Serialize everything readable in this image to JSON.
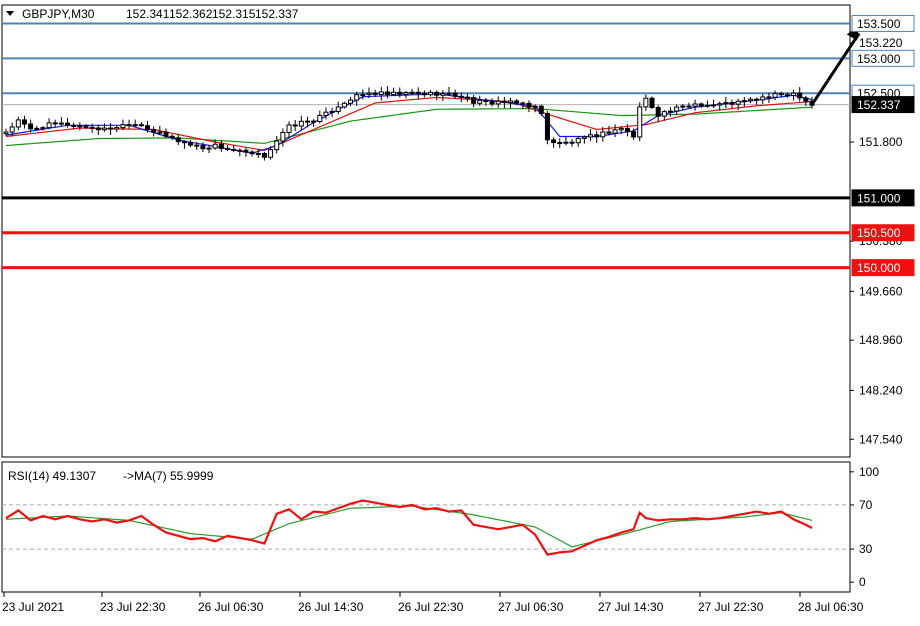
{
  "header": {
    "symbol_label": "GBPJPY,M30",
    "ohlc": [
      "152.341",
      "152.362",
      "152.315",
      "152.337"
    ]
  },
  "rsi_header": {
    "rsi_label": "RSI(14) 49.1307",
    "ma_label": "->MA(7) 55.9999"
  },
  "colors": {
    "background": "#ffffff",
    "frame": "#000000",
    "candle": "#000000",
    "ma_fast": "#1515ee",
    "ma_mid": "#e01010",
    "ma_slow": "#149614",
    "level_blue": "#4f83b8",
    "level_black": "#000000",
    "level_red": "#ee1111",
    "rsi_line": "#ee1111",
    "rsi_ma": "#2c9a2c",
    "arrow": "#000000"
  },
  "chart_data": [
    {
      "type": "candlestick",
      "symbol": "GBPJPY",
      "timeframe": "M30",
      "ylim": [
        147.3,
        153.75
      ],
      "y_ticks": [
        "153.220",
        "151.800",
        "150.380",
        "149.660",
        "148.960",
        "148.240",
        "147.540"
      ],
      "x_ticks": [
        "23 Jul 2021",
        "23 Jul 22:30",
        "26 Jul 06:30",
        "26 Jul 14:30",
        "26 Jul 22:30",
        "27 Jul 06:30",
        "27 Jul 14:30",
        "27 Jul 22:30",
        "28 Jul 06:30"
      ],
      "close_profile": [
        [
          0,
          151.95
        ],
        [
          2,
          152.1
        ],
        [
          4,
          151.98
        ],
        [
          6,
          152.03
        ],
        [
          8,
          152.06
        ],
        [
          10,
          152.05
        ],
        [
          13,
          152.02
        ],
        [
          16,
          151.98
        ],
        [
          18,
          152.02
        ],
        [
          20,
          152.07
        ],
        [
          22,
          152.05
        ],
        [
          24,
          151.95
        ],
        [
          26,
          151.88
        ],
        [
          28,
          151.82
        ],
        [
          30,
          151.76
        ],
        [
          32,
          151.72
        ],
        [
          34,
          151.75
        ],
        [
          36,
          151.7
        ],
        [
          38,
          151.66
        ],
        [
          40,
          151.62
        ],
        [
          42,
          151.6
        ],
        [
          44,
          151.82
        ],
        [
          46,
          152.02
        ],
        [
          48,
          152.08
        ],
        [
          50,
          152.12
        ],
        [
          52,
          152.2
        ],
        [
          54,
          152.32
        ],
        [
          56,
          152.42
        ],
        [
          58,
          152.48
        ],
        [
          60,
          152.5
        ],
        [
          62,
          152.48
        ],
        [
          64,
          152.49
        ],
        [
          66,
          152.5
        ],
        [
          68,
          152.49
        ],
        [
          70,
          152.5
        ],
        [
          72,
          152.48
        ],
        [
          74,
          152.46
        ],
        [
          76,
          152.38
        ],
        [
          78,
          152.36
        ],
        [
          80,
          152.38
        ],
        [
          82,
          152.36
        ],
        [
          84,
          152.35
        ],
        [
          86,
          152.3
        ],
        [
          87,
          152.2
        ],
        [
          88,
          151.85
        ],
        [
          89,
          151.8
        ],
        [
          90,
          151.78
        ],
        [
          92,
          151.8
        ],
        [
          94,
          151.85
        ],
        [
          96,
          151.9
        ],
        [
          98,
          151.95
        ],
        [
          100,
          152.0
        ],
        [
          102,
          151.88
        ],
        [
          103,
          152.3
        ],
        [
          104,
          152.42
        ],
        [
          106,
          152.2
        ],
        [
          108,
          152.25
        ],
        [
          110,
          152.3
        ],
        [
          112,
          152.35
        ],
        [
          114,
          152.33
        ],
        [
          116,
          152.34
        ],
        [
          118,
          152.36
        ],
        [
          120,
          152.38
        ],
        [
          122,
          152.42
        ],
        [
          124,
          152.45
        ],
        [
          126,
          152.48
        ],
        [
          128,
          152.5
        ],
        [
          129,
          152.46
        ],
        [
          130,
          152.4
        ],
        [
          131,
          152.337
        ]
      ],
      "series": [
        {
          "name": "",
          "role": "fast MA",
          "values": [
            [
              0,
              151.9
            ],
            [
              10,
              152.04
            ],
            [
              20,
              152.04
            ],
            [
              28,
              151.83
            ],
            [
              40,
              151.64
            ],
            [
              44,
              151.75
            ],
            [
              50,
              152.08
            ],
            [
              58,
              152.45
            ],
            [
              70,
              152.49
            ],
            [
              80,
              152.38
            ],
            [
              86,
              152.31
            ],
            [
              90,
              151.88
            ],
            [
              96,
              151.88
            ],
            [
              102,
              151.96
            ],
            [
              106,
              152.18
            ],
            [
              112,
              152.3
            ],
            [
              122,
              152.4
            ],
            [
              128,
              152.47
            ],
            [
              131,
              152.41
            ]
          ]
        },
        {
          "name": "",
          "role": "mid MA",
          "values": [
            [
              0,
              151.88
            ],
            [
              12,
              152.0
            ],
            [
              24,
              151.98
            ],
            [
              34,
              151.8
            ],
            [
              42,
              151.68
            ],
            [
              50,
              151.98
            ],
            [
              60,
              152.36
            ],
            [
              70,
              152.44
            ],
            [
              82,
              152.38
            ],
            [
              88,
              152.2
            ],
            [
              96,
              151.98
            ],
            [
              104,
              152.05
            ],
            [
              112,
              152.22
            ],
            [
              122,
              152.32
            ],
            [
              131,
              152.38
            ]
          ]
        },
        {
          "name": "",
          "role": "slow MA",
          "values": [
            [
              0,
              151.75
            ],
            [
              15,
              151.85
            ],
            [
              28,
              151.86
            ],
            [
              42,
              151.78
            ],
            [
              56,
              152.1
            ],
            [
              70,
              152.27
            ],
            [
              86,
              152.28
            ],
            [
              100,
              152.18
            ],
            [
              112,
              152.2
            ],
            [
              131,
              152.3
            ]
          ]
        }
      ],
      "levels": [
        {
          "value": 153.5,
          "label": "153.500",
          "color": "#4f83b8"
        },
        {
          "value": 153.0,
          "label": "153.000",
          "color": "#4f83b8"
        },
        {
          "value": 152.5,
          "label": "152.500",
          "color": "#4f83b8"
        },
        {
          "value": 152.337,
          "label": "152.337",
          "color": "#000000",
          "current": true
        },
        {
          "value": 151.0,
          "label": "151.000",
          "color": "#000000"
        },
        {
          "value": 150.5,
          "label": "150.500",
          "color": "#ee1111"
        },
        {
          "value": 150.0,
          "label": "150.000",
          "color": "#ee1111"
        }
      ],
      "projection_arrow": {
        "from": [
          131,
          152.337
        ],
        "to": [
          138,
          153.5
        ]
      }
    },
    {
      "type": "line",
      "indicator": "RSI(14)",
      "ylim": [
        -8,
        108
      ],
      "y_ticks": [
        "100",
        "70",
        "30",
        "0"
      ],
      "levels": [
        70,
        30
      ],
      "series": [
        {
          "name": "RSI(14)",
          "values": [
            [
              0,
              58
            ],
            [
              2,
              65
            ],
            [
              4,
              56
            ],
            [
              6,
              60
            ],
            [
              8,
              57
            ],
            [
              10,
              60
            ],
            [
              12,
              57
            ],
            [
              14,
              55
            ],
            [
              16,
              57
            ],
            [
              18,
              54
            ],
            [
              20,
              56
            ],
            [
              22,
              60
            ],
            [
              24,
              52
            ],
            [
              26,
              45
            ],
            [
              28,
              42
            ],
            [
              30,
              39
            ],
            [
              32,
              40
            ],
            [
              34,
              37
            ],
            [
              36,
              42
            ],
            [
              38,
              40
            ],
            [
              40,
              38
            ],
            [
              42,
              35
            ],
            [
              44,
              62
            ],
            [
              46,
              66
            ],
            [
              48,
              57
            ],
            [
              50,
              64
            ],
            [
              52,
              63
            ],
            [
              54,
              67
            ],
            [
              56,
              71
            ],
            [
              58,
              74
            ],
            [
              60,
              72
            ],
            [
              62,
              70
            ],
            [
              64,
              68
            ],
            [
              66,
              70
            ],
            [
              68,
              66
            ],
            [
              70,
              67
            ],
            [
              72,
              64
            ],
            [
              74,
              65
            ],
            [
              76,
              52
            ],
            [
              78,
              50
            ],
            [
              80,
              48
            ],
            [
              82,
              50
            ],
            [
              84,
              52
            ],
            [
              86,
              43
            ],
            [
              88,
              25
            ],
            [
              90,
              27
            ],
            [
              92,
              28
            ],
            [
              94,
              33
            ],
            [
              96,
              38
            ],
            [
              98,
              41
            ],
            [
              100,
              45
            ],
            [
              102,
              48
            ],
            [
              103,
              63
            ],
            [
              104,
              58
            ],
            [
              106,
              56
            ],
            [
              108,
              57
            ],
            [
              110,
              57
            ],
            [
              112,
              58
            ],
            [
              114,
              57
            ],
            [
              116,
              58
            ],
            [
              118,
              60
            ],
            [
              120,
              62
            ],
            [
              122,
              64
            ],
            [
              124,
              62
            ],
            [
              126,
              64
            ],
            [
              128,
              57
            ],
            [
              130,
              52
            ],
            [
              131,
              49.13
            ]
          ]
        },
        {
          "name": "MA(7)",
          "values": [
            [
              0,
              57
            ],
            [
              10,
              60
            ],
            [
              20,
              56
            ],
            [
              30,
              44
            ],
            [
              40,
              39
            ],
            [
              46,
              53
            ],
            [
              56,
              67
            ],
            [
              66,
              69
            ],
            [
              76,
              61
            ],
            [
              86,
              50
            ],
            [
              92,
              32
            ],
            [
              100,
              43
            ],
            [
              108,
              55
            ],
            [
              120,
              59
            ],
            [
              126,
              63
            ],
            [
              131,
              56
            ]
          ]
        }
      ]
    }
  ]
}
